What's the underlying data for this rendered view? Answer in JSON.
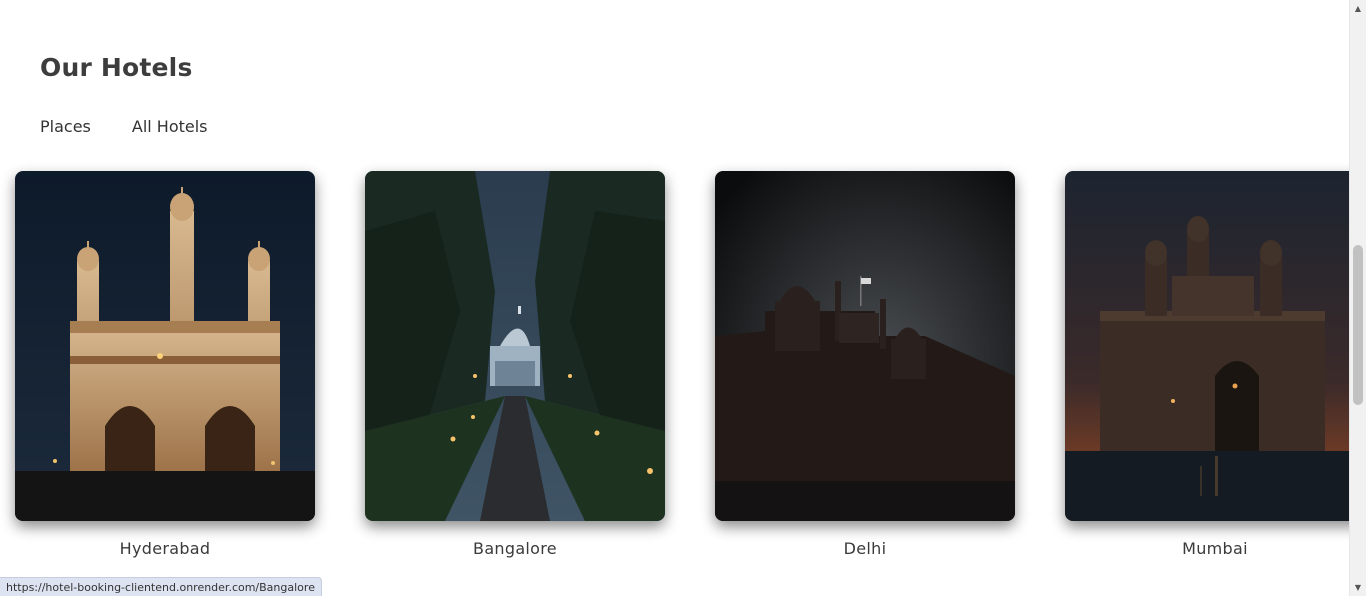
{
  "section": {
    "title": "Our Hotels",
    "tabs": [
      "Places",
      "All Hotels"
    ]
  },
  "cities": [
    {
      "name": "Hyderabad",
      "image": "charminar-night"
    },
    {
      "name": "Bangalore",
      "image": "glass-house-garden-night"
    },
    {
      "name": "Delhi",
      "image": "red-fort-night"
    },
    {
      "name": "Mumbai",
      "image": "gateway-of-india-dusk"
    }
  ],
  "status_bar": {
    "url": "https://hotel-booking-clientend.onrender.com/Bangalore"
  },
  "colors": {
    "title_text": "#3d3d3d",
    "label_text": "#3a3a3a",
    "status_bg": "#dee3f1"
  }
}
